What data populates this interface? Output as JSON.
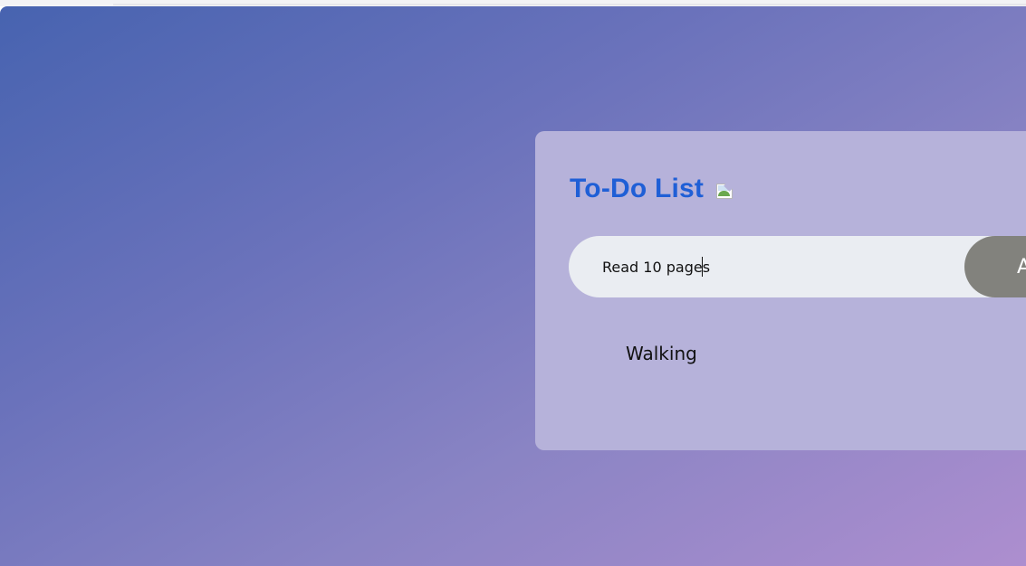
{
  "app": {
    "title": "To-Do List",
    "title_image_alt": ""
  },
  "input": {
    "value": "Read 10 pages",
    "placeholder": ""
  },
  "add_button": {
    "label": "A"
  },
  "tasks": [
    {
      "label": "Walking"
    }
  ],
  "colors": {
    "background_start": "#4763b0",
    "background_end": "#ad8ecf",
    "card": "#b6b2da",
    "title": "#1f5fd6",
    "input_bg": "#eaedf2",
    "button_bg": "#82827d"
  }
}
